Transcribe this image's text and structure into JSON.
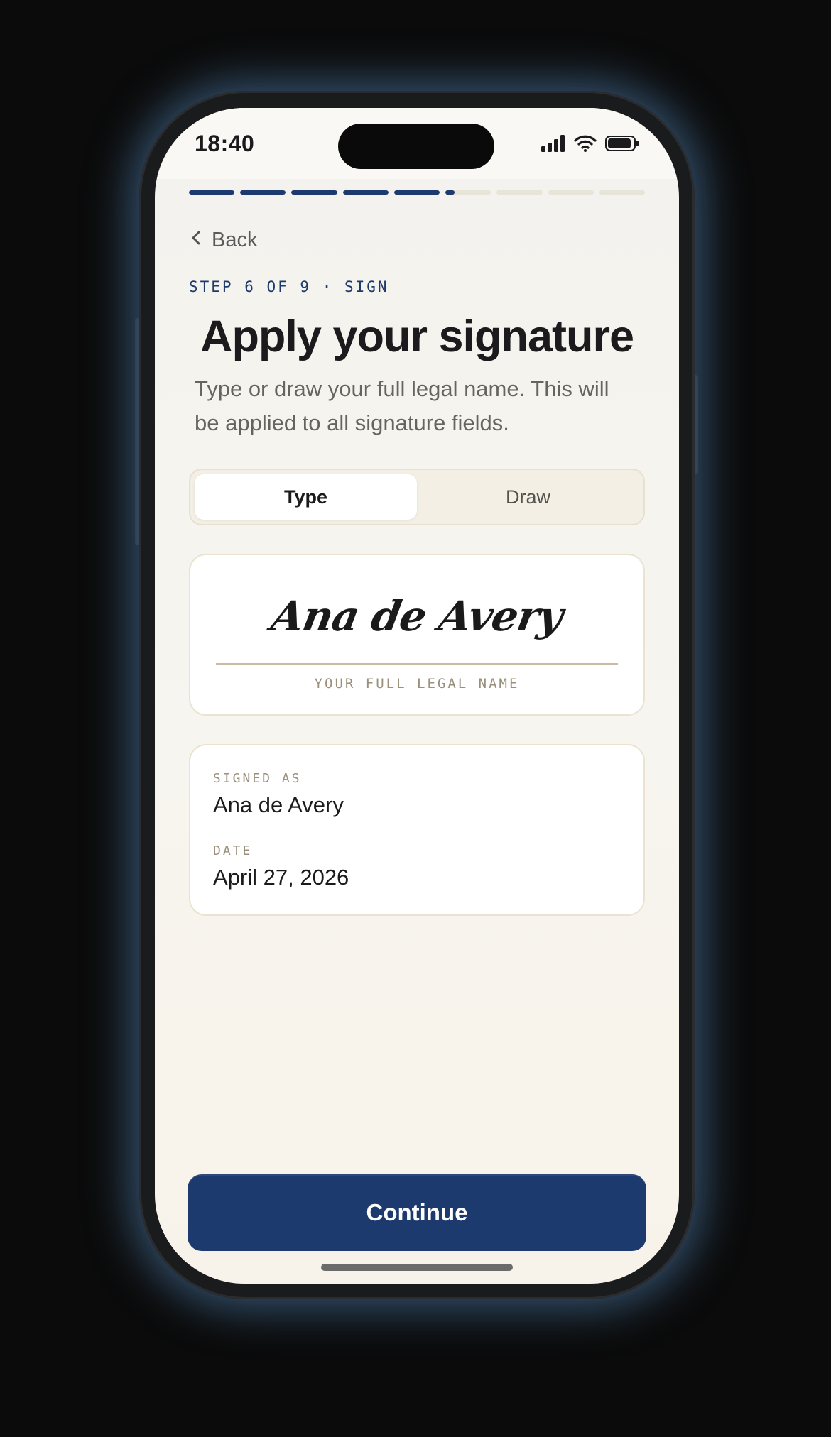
{
  "status_bar": {
    "time": "18:40"
  },
  "progress": {
    "total_steps": 9,
    "segments_fill": [
      1,
      1,
      1,
      1,
      1,
      0.2,
      0,
      0,
      0
    ]
  },
  "nav": {
    "back_label": "Back"
  },
  "header": {
    "step_label": "STEP 6 OF 9 · SIGN",
    "title": "Apply your signature",
    "subtitle": "Type or draw your full legal name. This will be applied to all signature fields."
  },
  "mode_toggle": {
    "options": [
      "Type",
      "Draw"
    ],
    "selected": "Type"
  },
  "signature": {
    "value": "Ana de Avery",
    "caption": "YOUR FULL LEGAL NAME"
  },
  "summary": {
    "signed_as_label": "SIGNED AS",
    "signed_as_value": "Ana de Avery",
    "date_label": "DATE",
    "date_value": "April 27, 2026"
  },
  "actions": {
    "continue_label": "Continue"
  },
  "colors": {
    "accent": "#1c3a6e",
    "progress_track": "#e9e4d8"
  },
  "icons": {
    "back": "chevron-left-icon",
    "signal": "cellular-signal-icon",
    "wifi": "wifi-icon",
    "battery": "battery-icon"
  }
}
